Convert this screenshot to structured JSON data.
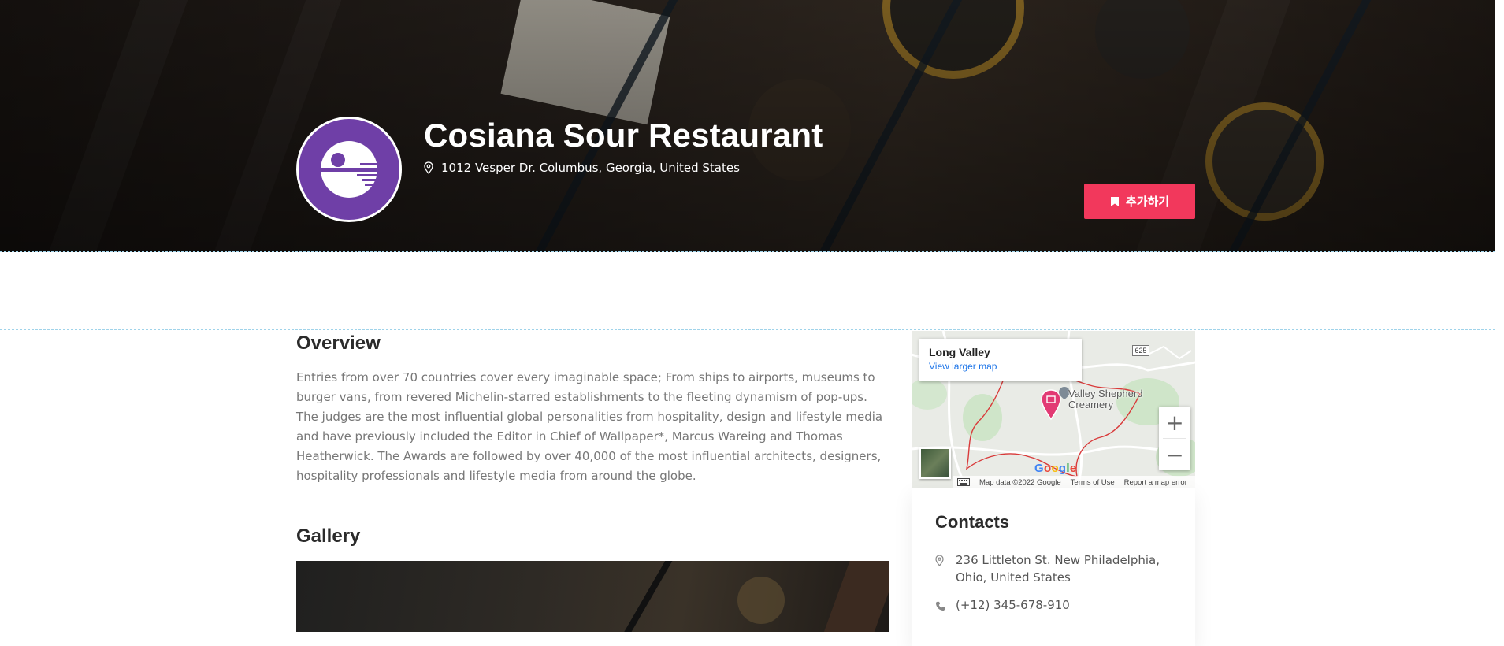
{
  "hero": {
    "title": "Cosiana Sour Restaurant",
    "address": "1012 Vesper Dr. Columbus, Georgia, United States",
    "add_button_label": "추가하기",
    "logo_color": "#6f3fa7",
    "logo_icon": "death-star-icon"
  },
  "overview": {
    "title": "Overview",
    "paragraph_1": "Entries from over 70 countries cover every imaginable space; From ships to airports, museums to burger vans, from revered Michelin-starred establishments to the fleeting dynamism of pop-ups.",
    "paragraph_2": "The judges are the most influential global personalities from hospitality, design and lifestyle media and have previously included the Editor in Chief of Wallpaper*, Marcus Wareing and Thomas Heatherwick. The Awards are followed by over 40,000 of the most influential architects, designers, hospitality professionals and lifestyle media from around the globe."
  },
  "gallery": {
    "title": "Gallery"
  },
  "map": {
    "place_name": "Long Valley",
    "larger_map_link": "View larger map",
    "marker_label": "Valley Shepherd Creamery",
    "route_shield": "625",
    "zoom_in": "+",
    "zoom_out": "−",
    "logo": "Google",
    "footer": {
      "map_data": "Map data ©2022 Google",
      "terms": "Terms of Use",
      "report": "Report a map error"
    }
  },
  "contacts": {
    "title": "Contacts",
    "address_line_1": "236 Littleton St. New Philadelphia,",
    "address_line_2": "Ohio, United States",
    "phone": "(+12) 345-678-910"
  },
  "colors": {
    "accent": "#f2385c",
    "map_link": "#1a73e8"
  }
}
